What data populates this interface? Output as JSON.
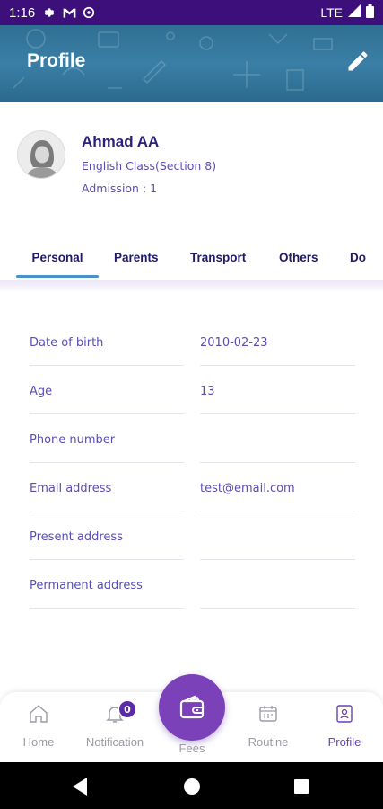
{
  "status_bar": {
    "time": "1:16",
    "network": "LTE",
    "icons": [
      "settings-icon",
      "gmail-icon",
      "app-icon",
      "signal-icon",
      "battery-icon"
    ]
  },
  "header": {
    "title": "Profile",
    "edit_icon": "pencil-icon"
  },
  "profile": {
    "name": "Ahmad AA",
    "class": "English Class(Section 8)",
    "admission": "Admission : 1"
  },
  "tabs": [
    {
      "label": "Personal",
      "active": true
    },
    {
      "label": "Parents",
      "active": false
    },
    {
      "label": "Transport",
      "active": false
    },
    {
      "label": "Others",
      "active": false
    },
    {
      "label": "Do",
      "active": false
    }
  ],
  "personal_info": [
    {
      "label": "Date of birth",
      "value": "2010-02-23"
    },
    {
      "label": "Age",
      "value": "13"
    },
    {
      "label": "Phone number",
      "value": ""
    },
    {
      "label": "Email address",
      "value": "test@email.com"
    },
    {
      "label": "Present address",
      "value": ""
    },
    {
      "label": "Permanent address",
      "value": ""
    }
  ],
  "bottom_nav": {
    "home": "Home",
    "notification": "Notification",
    "notification_count": "0",
    "fees": "Fees",
    "routine": "Routine",
    "profile": "Profile",
    "active": "Profile"
  },
  "colors": {
    "status_bar": "#3c0f7a",
    "header": "#3b7fa6",
    "accent": "#7a41b8",
    "text_primary": "#2a1f7a",
    "text_secondary": "#5a4fb3",
    "tab_indicator": "#4a90c9"
  }
}
